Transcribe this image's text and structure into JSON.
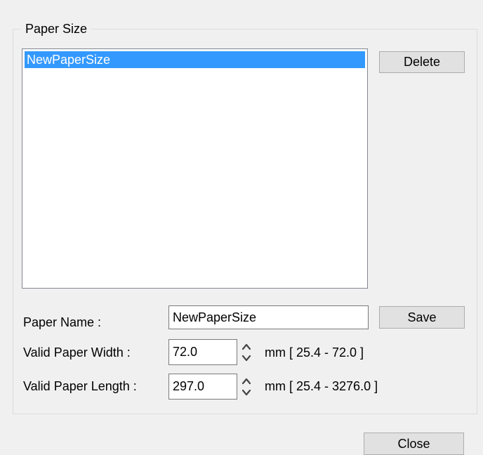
{
  "paper_size_group": {
    "title": "Paper Size",
    "list_items": [
      "NewPaperSize"
    ],
    "delete_label": "Delete"
  },
  "paper_name": {
    "label": "Paper Name :",
    "value": "NewPaperSize",
    "save_label": "Save"
  },
  "paper_width": {
    "label": "Valid Paper Width :",
    "value": "72.0",
    "range": "mm [ 25.4 - 72.0 ]"
  },
  "paper_length": {
    "label": "Valid Paper Length :",
    "value": "297.0",
    "range": "mm [ 25.4 - 3276.0 ]"
  },
  "footer": {
    "close_label": "Close"
  },
  "colors": {
    "background": "#f0f0f0",
    "selection": "#3399ff",
    "button_face": "#e1e1e1"
  }
}
